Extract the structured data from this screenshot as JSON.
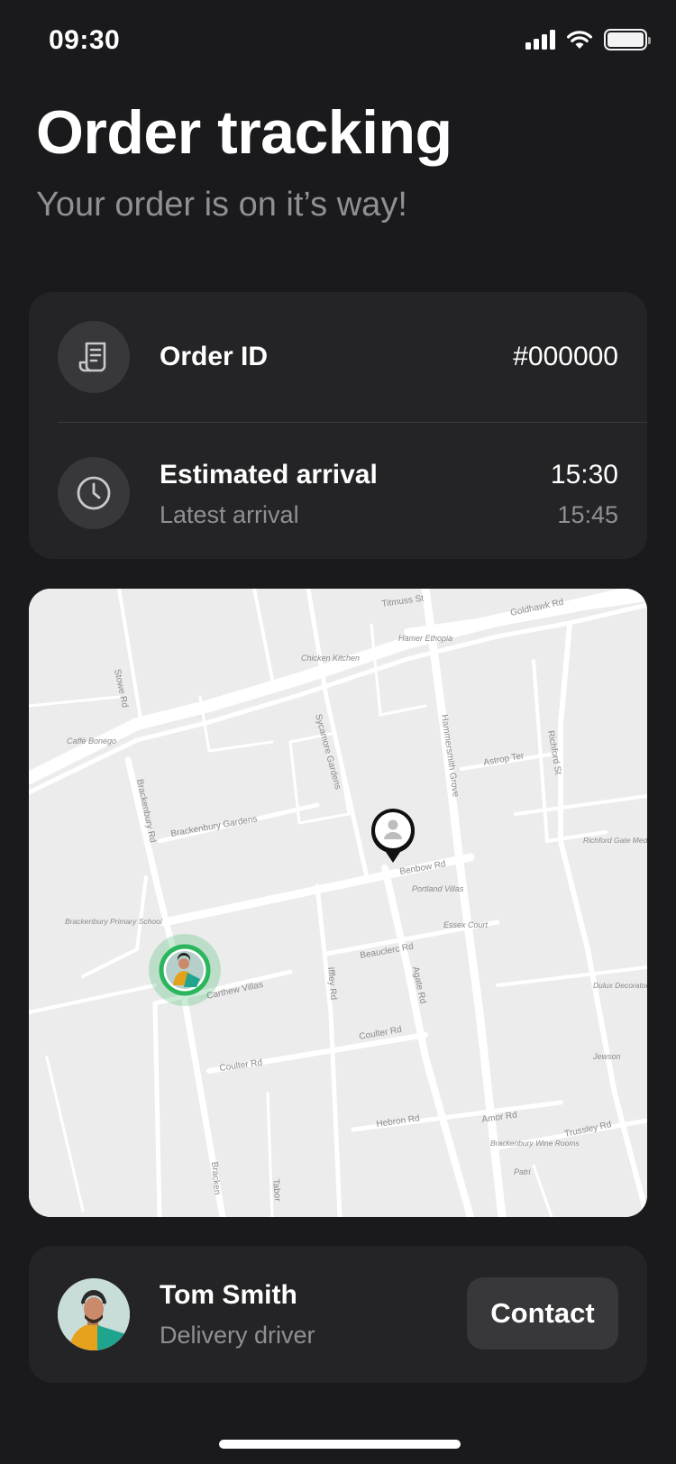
{
  "status_bar": {
    "time": "09:30"
  },
  "header": {
    "title": "Order tracking",
    "subtitle": "Your order is on it’s way!"
  },
  "order": {
    "id_label": "Order ID",
    "id_value": "#000000",
    "arrival_label": "Estimated arrival",
    "arrival_value": "15:30",
    "latest_label": "Latest arrival",
    "latest_value": "15:45",
    "icons": {
      "order": "receipt-icon",
      "arrival": "clock-icon"
    }
  },
  "map": {
    "streets": {
      "titmuss": "Titmuss St",
      "goldhawk": "Goldhawk Rd",
      "hamer": "Hamer Ethopia",
      "chicken": "Chicken Kitchen",
      "stowe": "Stowe Rd",
      "caffe": "Caffè Bonego",
      "sycamore": "Sycamore Gardens",
      "hammersmith": "Hammersmith Grove",
      "astrop": "Astrop Ter",
      "richford": "Richford St",
      "brackenbury_rd": "Brackenbury Rd",
      "brackenbury_gardens": "Brackenbury Gardens",
      "benbow": "Benbow Rd",
      "portland": "Portland Villas",
      "richford_medical": "Richford Gate Medical Centre",
      "brackenbury_school": "Brackenbury Primary School",
      "essex": "Essex Court",
      "beauclerc": "Beauclerc Rd",
      "carthew": "Carthew Villas",
      "iffley": "Iffley Rd",
      "agate": "Agate Rd",
      "dulux": "Dulux Decorator",
      "coulter_1": "Coulter Rd",
      "coulter_2": "Coulter Rd",
      "jewson": "Jewson",
      "hebron": "Hebron Rd",
      "amor": "Amor Rd",
      "trussley": "Trussley Rd",
      "wine_rooms": "Brackenbury Wine Rooms",
      "patri": "Patri",
      "brackenbury_bottom": "Bracken",
      "tabor": "Tabor"
    }
  },
  "driver": {
    "name": "Tom Smith",
    "role": "Delivery driver",
    "contact_label": "Contact"
  },
  "colors": {
    "background": "#1a1a1c",
    "card": "#242426",
    "accent_green": "#2bb55c",
    "muted_text": "#8f8f94"
  }
}
